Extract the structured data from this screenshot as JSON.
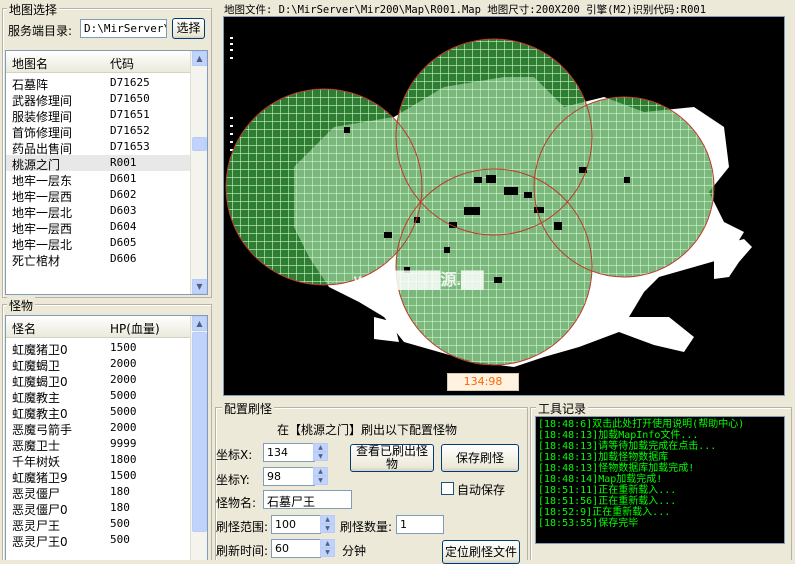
{
  "map_select": {
    "title": "地图选择",
    "server_dir_label": "服务端目录:",
    "server_dir_value": "D:\\MirServer\\",
    "select_button": "选择",
    "columns": [
      "地图名",
      "代码"
    ],
    "rows": [
      {
        "name": "石墓阵",
        "code": "D71625"
      },
      {
        "name": "武器修理间",
        "code": "D71650"
      },
      {
        "name": "服装修理间",
        "code": "D71651"
      },
      {
        "name": "首饰修理间",
        "code": "D71652"
      },
      {
        "name": "药品出售间",
        "code": "D71653"
      },
      {
        "name": "桃源之门",
        "code": "R001"
      },
      {
        "name": "地牢一层东",
        "code": "D601"
      },
      {
        "name": "地牢一层西",
        "code": "D602"
      },
      {
        "name": "地牢一层北",
        "code": "D603"
      },
      {
        "name": "地牢一层西",
        "code": "D604"
      },
      {
        "name": "地牢一层北",
        "code": "D605"
      },
      {
        "name": "死亡棺材",
        "code": "D606"
      }
    ]
  },
  "monsters": {
    "title": "怪物",
    "columns": [
      "怪名",
      "HP(血量)"
    ],
    "rows": [
      {
        "name": "虹魔猪卫0",
        "hp": "1500"
      },
      {
        "name": "虹魔蝎卫",
        "hp": "2000"
      },
      {
        "name": "虹魔蝎卫0",
        "hp": "2000"
      },
      {
        "name": "虹魔教主",
        "hp": "5000"
      },
      {
        "name": "虹魔教主0",
        "hp": "5000"
      },
      {
        "name": "恶魔弓箭手",
        "hp": "2000"
      },
      {
        "name": "恶魔卫士",
        "hp": "9999"
      },
      {
        "name": "千年树妖",
        "hp": "1800"
      },
      {
        "name": "虹魔猪卫9",
        "hp": "1500"
      },
      {
        "name": "恶灵僵尸",
        "hp": "180"
      },
      {
        "name": "恶灵僵尸0",
        "hp": "180"
      },
      {
        "name": "恶灵尸王",
        "hp": "500"
      },
      {
        "name": "恶灵尸王0",
        "hp": "500"
      }
    ]
  },
  "map_view": {
    "header": "地图文件: D:\\MirServer\\Mir200\\Map\\R001.Map 地图尺寸:200X200 引擎(M2)识别代码:R001",
    "coord_readout": "134:98",
    "watermark": "www.████源.██"
  },
  "config": {
    "title": "配置刷怪",
    "banner": "在【桃源之门】刷出以下配置怪物",
    "x_label": "坐标X:",
    "x_value": "134",
    "y_label": "坐标Y:",
    "y_value": "98",
    "monster_label": "怪物名:",
    "monster_value": "石墓尸王",
    "range_label": "刷怪范围:",
    "range_value": "100",
    "count_label": "刷怪数量:",
    "count_value": "1",
    "time_label": "刷新时间:",
    "time_value": "60",
    "time_unit": "分钟",
    "view_button": "查看已刷出怪物",
    "save_button": "保存刷怪",
    "autosave_label": "自动保存",
    "locate_button": "定位刷怪文件"
  },
  "tools": {
    "title": "工具记录",
    "log": [
      "[18:48:6]双击此处打开使用说明(帮助中心)",
      "[18:48:13]加载MapInfo文件...",
      "[18:48:13]请等待加载完成在点击...",
      "[18:48:13]加载怪物数据库",
      "[18:48:13]怪物数据库加载完成!",
      "[18:48:14]Map加载完成!",
      "[18:51:11]正在重新载入...",
      "[18:51:56]正在重新载入...",
      "[18:52:9]正在重新载入...",
      "[18:53:55]保存完毕"
    ]
  },
  "colors": {
    "log_text": "#00ff00",
    "spawn_fill": "#2e7d32",
    "spawn_border": "#c0392b",
    "land": "#ccf5cc",
    "void": "#000000",
    "coord_text": "#ff6600"
  }
}
